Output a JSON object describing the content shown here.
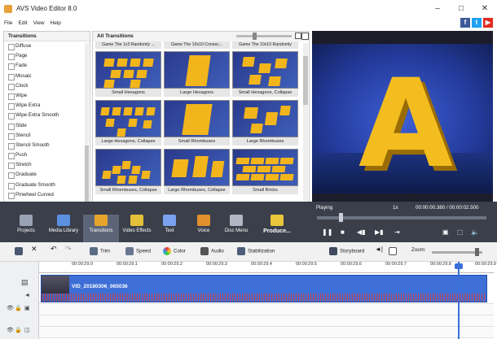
{
  "window": {
    "title": "AVS Video Editor 8.0",
    "minimize": "–",
    "maximize": "□",
    "close": "✕"
  },
  "menu": [
    "File",
    "Edit",
    "View",
    "Help"
  ],
  "social": {
    "facebook": "f",
    "twitter": "t",
    "youtube": "▶"
  },
  "tree": {
    "header": "Transitions",
    "items": [
      "Diffuse",
      "Page",
      "Fade",
      "Mosaic",
      "Clock",
      "Wipe",
      "Wipe Extra",
      "Wipe Extra Smooth",
      "Slide",
      "Stencil",
      "Stencil Smooth",
      "Push",
      "Stretch",
      "Graduate",
      "Graduate Smooth",
      "Pinwheel Curved",
      "Pinwheel Curved Smooth"
    ]
  },
  "gallery": {
    "header": "All Transitions",
    "top_labels": [
      "Game The 1x3 Randomly ...",
      "Game The 10x10 Consec...",
      "Game The 10x10 Randomly"
    ],
    "items": [
      {
        "label": "Small Hexagons"
      },
      {
        "label": "Large Hexagons"
      },
      {
        "label": "Small Hexagons, Collapse"
      },
      {
        "label": "Large Hexagons, Collapse"
      },
      {
        "label": "Small Rhombuses"
      },
      {
        "label": "Large Rhombuses"
      },
      {
        "label": "Small Rhombuses, Collapse"
      },
      {
        "label": "Large Rhombuses, Collapse"
      },
      {
        "label": "Small Bricks"
      }
    ]
  },
  "preview": {
    "status": "Playing",
    "rate": "1x",
    "time": "00:00:00.380 / 00:00:02.500",
    "progress": 0.13
  },
  "tools": [
    {
      "label": "Projects",
      "color": "#9aa3b5"
    },
    {
      "label": "Media Library",
      "color": "#5b8fe0"
    },
    {
      "label": "Transitions",
      "color": "#e7a42b"
    },
    {
      "label": "Video Effects",
      "color": "#e3c13a"
    },
    {
      "label": "Text",
      "color": "#7aa2ef"
    },
    {
      "label": "Voice",
      "color": "#e0902c"
    },
    {
      "label": "Disc Menu",
      "color": "#b0b6c4"
    },
    {
      "label": "Produce...",
      "color": "#e8c53b"
    }
  ],
  "timeline_toolbar": {
    "trim": "Trim",
    "speed": "Speed",
    "color": "Color",
    "audio": "Audio",
    "stabilization": "Stabilization",
    "storyboard": "Storyboard",
    "zoom": "Zoom:"
  },
  "ruler": [
    "00:00:29.0",
    "00:00:29.1",
    "00:00:29.2",
    "00:00:29.3",
    "00:00:29.4",
    "00:00:29.5",
    "00:00:29.6",
    "00:00:29.7",
    "00:00:29.8",
    "00:00:29.9"
  ],
  "clip": {
    "name": "VID_20180306_065036"
  }
}
